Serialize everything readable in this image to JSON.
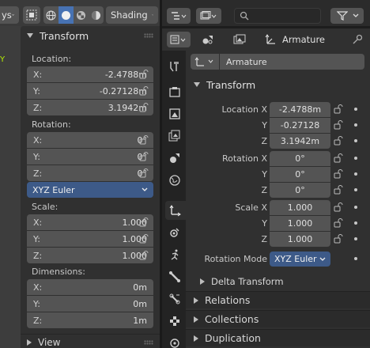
{
  "viewport": {
    "mode_fragment": "ys",
    "shading_label": "Shading",
    "axis_letter": "Y"
  },
  "npanel": {
    "title": "Transform",
    "location_label": "Location:",
    "location": [
      {
        "axis": "X:",
        "value": "-2.4788m"
      },
      {
        "axis": "Y:",
        "value": "-0.27128m"
      },
      {
        "axis": "Z:",
        "value": "3.1942m"
      }
    ],
    "rotation_label": "Rotation:",
    "rotation": [
      {
        "axis": "X:",
        "value": "0°"
      },
      {
        "axis": "Y:",
        "value": "0°"
      },
      {
        "axis": "Z:",
        "value": "0°"
      }
    ],
    "rotation_mode": "XYZ Euler",
    "scale_label": "Scale:",
    "scale": [
      {
        "axis": "X:",
        "value": "1.000"
      },
      {
        "axis": "Y:",
        "value": "1.000"
      },
      {
        "axis": "Z:",
        "value": "1.000"
      }
    ],
    "dimensions_label": "Dimensions:",
    "dimensions": [
      {
        "axis": "X:",
        "value": "0m"
      },
      {
        "axis": "Y:",
        "value": "0m"
      },
      {
        "axis": "Z:",
        "value": "1m"
      }
    ],
    "view_label": "View"
  },
  "properties": {
    "object_name": "Armature",
    "context_name": "Armature",
    "transform_title": "Transform",
    "location_labels": [
      "Location X",
      "Y",
      "Z"
    ],
    "location_values": [
      "-2.4788m",
      "-0.27128",
      "3.1942m"
    ],
    "rotation_labels": [
      "Rotation X",
      "Y",
      "Z"
    ],
    "rotation_values": [
      "0°",
      "0°",
      "0°"
    ],
    "scale_labels": [
      "Scale X",
      "Y",
      "Z"
    ],
    "scale_values": [
      "1.000",
      "1.000",
      "1.000"
    ],
    "rotation_mode_label": "Rotation Mode",
    "rotation_mode_value": "XYZ Euler",
    "delta_transform": "Delta Transform",
    "collapsed_sections": [
      "Relations",
      "Collections",
      "Duplication"
    ]
  },
  "colors": {
    "accent_active": "#4772b3",
    "dropdown_blue": "#3d5a88",
    "field_bg": "#545454",
    "panel_bg": "#303030"
  }
}
